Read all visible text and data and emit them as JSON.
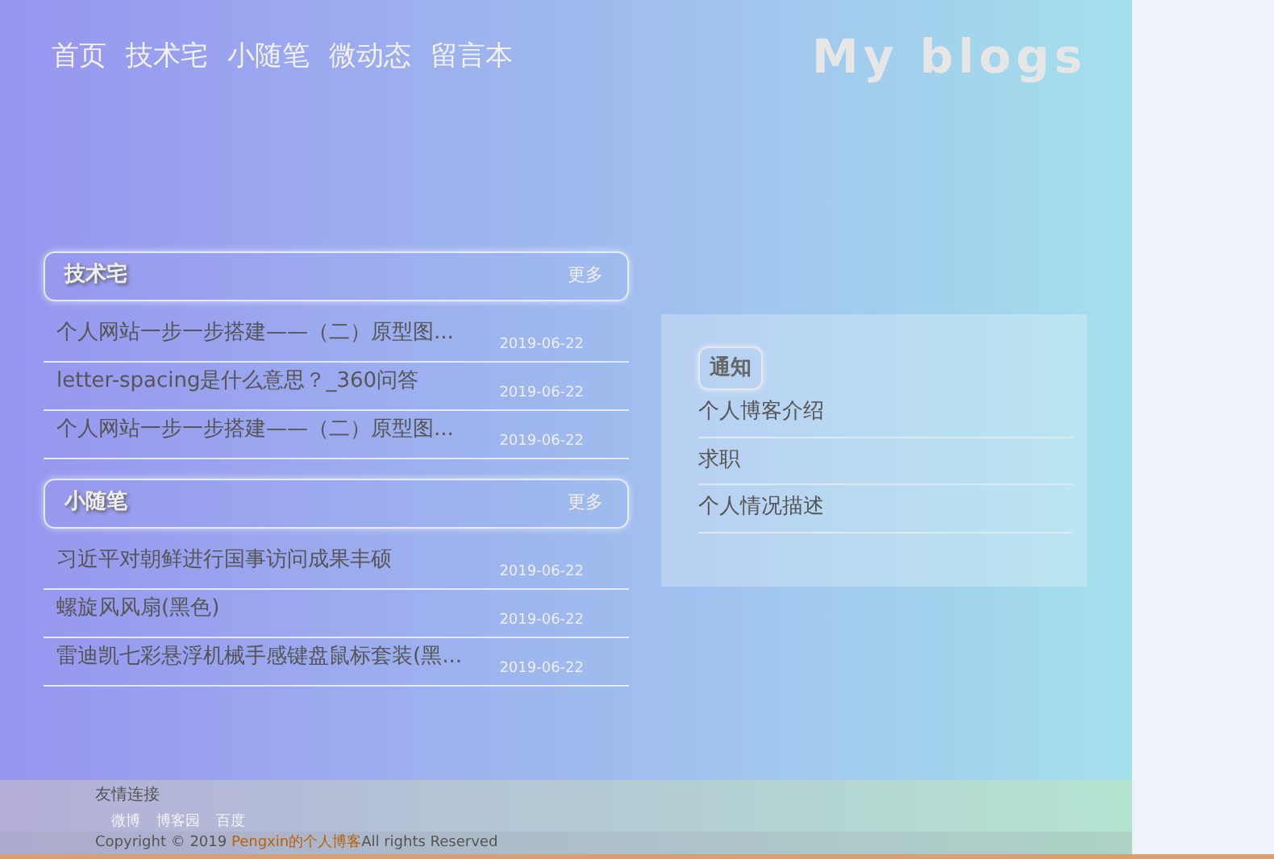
{
  "nav": {
    "links": [
      "首页",
      "技术宅",
      "小随笔",
      "微动态",
      "留言本"
    ],
    "brand": "My blogs"
  },
  "sections": [
    {
      "title": "技术宅",
      "more": "更多",
      "posts": [
        {
          "title": "个人网站一步一步搭建——（二）原型图...",
          "date": "2019-06-22"
        },
        {
          "title": "letter-spacing是什么意思？_360问答",
          "date": "2019-06-22"
        },
        {
          "title": "个人网站一步一步搭建——（二）原型图...",
          "date": "2019-06-22"
        }
      ]
    },
    {
      "title": "小随笔",
      "more": "更多",
      "posts": [
        {
          "title": "习近平对朝鲜进行国事访问成果丰硕",
          "date": "2019-06-22"
        },
        {
          "title": "螺旋风风扇(黑色)",
          "date": "2019-06-22"
        },
        {
          "title": "雷迪凯七彩悬浮机械手感键盘鼠标套装(黑...",
          "date": "2019-06-22"
        }
      ]
    }
  ],
  "notice": {
    "title": "通知",
    "items": [
      "个人博客介绍",
      "求职",
      "个人情况描述"
    ]
  },
  "footer": {
    "heading": "友情连接",
    "links": [
      "微博",
      "博客园",
      "百度"
    ],
    "copyright": {
      "before": "Copyright © 2019 ",
      "link": "Pengxin的个人博客",
      "after": "All rights Reserved"
    }
  }
}
